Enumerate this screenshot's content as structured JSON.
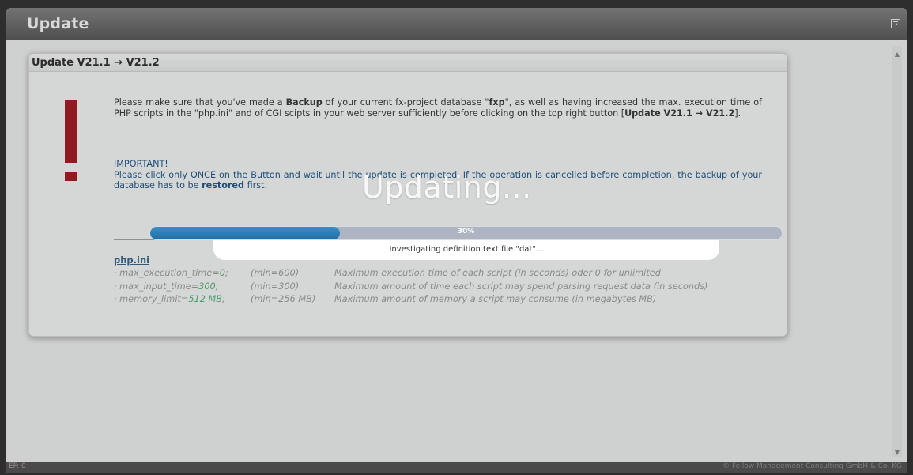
{
  "window": {
    "title": "Update"
  },
  "panel": {
    "title": "Update V21.1 → V21.2",
    "notice": {
      "part1": "Please make sure that you've made a ",
      "backup": "Backup",
      "part2": " of your current fx-project database \"",
      "db": "fxp",
      "part3": "\", as well as having increased the max. execution time of PHP scripts in the \"php.ini\" and of CGI scipts in your web server sufficiently before clicking on the top right button [",
      "button": "Update V21.1 → V21.2",
      "part4": "]."
    },
    "important": {
      "title": "IMPORTANT!",
      "part1": "Please click only ONCE on the Button and wait until the update is completed. If the operation is cancelled before completion, the backup of your database has to be ",
      "restored": "restored",
      "part2": " first."
    },
    "php": {
      "title": "php.ini",
      "rows": [
        {
          "key": "· max_execution_time=",
          "value": "0",
          "suffix": ";",
          "min": "(min=600)",
          "desc": "Maximum execution time of each script (in seconds) oder 0 for unlimited"
        },
        {
          "key": "· max_input_time=",
          "value": "300",
          "suffix": ";",
          "min": "(min=300)",
          "desc": "Maximum amount of time each script may spend parsing request data (in seconds)"
        },
        {
          "key": "· memory_limit=",
          "value": "512 MB",
          "suffix": ";",
          "min": "(min=256 MB)",
          "desc": "Maximum amount of memory a script may consume (in megabytes MB)"
        }
      ]
    }
  },
  "overlay": {
    "title": "Updating...",
    "progress_label": "30%",
    "progress_fraction": 0.3,
    "status": "Investigating definition text file \"dat\"..."
  },
  "footer": {
    "left": "EF: 0",
    "right": "© Fellow Management Consulting GmbH & Co. KG"
  }
}
